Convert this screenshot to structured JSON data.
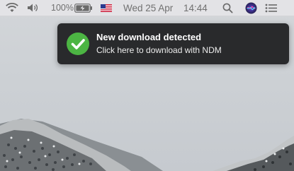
{
  "menubar": {
    "wifi_icon": "wifi-icon",
    "volume_icon": "volume-icon",
    "battery_percent": "100%",
    "battery_icon": "battery-charging-icon",
    "input_source_icon": "us-flag-icon",
    "date": "Wed 25 Apr",
    "time": "14:44",
    "spotlight_icon": "search-icon",
    "siri_icon": "siri-icon",
    "notification_center_icon": "list-icon"
  },
  "notification": {
    "icon": "checkmark-icon",
    "title": "New download detected",
    "body": "Click here to download with NDM",
    "colors": {
      "background": "#222224",
      "icon": "#4cb543",
      "title": "#ffffff"
    }
  }
}
